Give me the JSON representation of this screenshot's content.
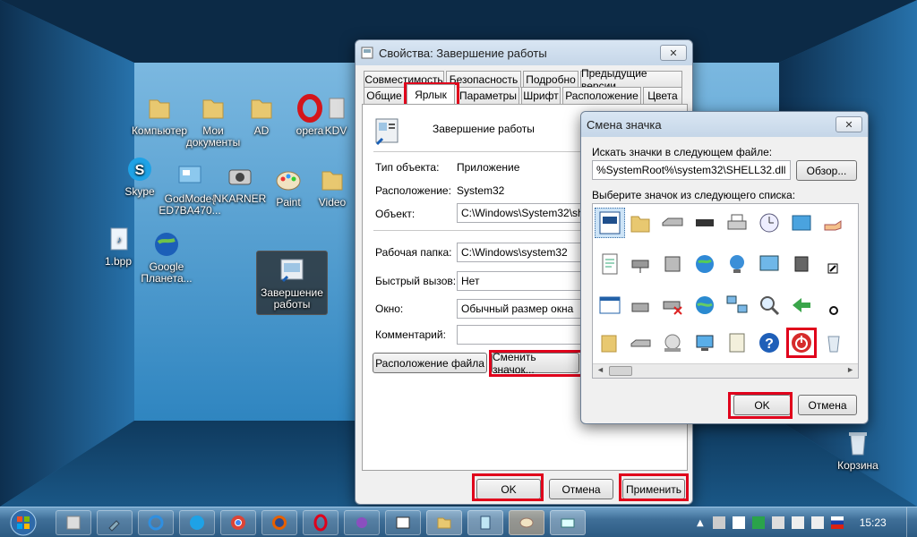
{
  "desktop": {
    "icons": [
      {
        "label": "Компьютер",
        "icon": "folder-icon"
      },
      {
        "label": "Мои документы",
        "icon": "folder-icon"
      },
      {
        "label": "AD",
        "icon": "folder-icon"
      },
      {
        "label": "opera",
        "icon": "opera-icon"
      },
      {
        "label": "KDV",
        "icon": "generic-icon"
      },
      {
        "label": "Skype",
        "icon": "skype-icon"
      },
      {
        "label": "GodMode{ ED7BA470...",
        "icon": "control-panel-icon"
      },
      {
        "label": "NKARNER",
        "icon": "camera-icon"
      },
      {
        "label": "Paint",
        "icon": "paint-icon"
      },
      {
        "label": "Video",
        "icon": "folder-icon"
      },
      {
        "label": "1.bpp",
        "icon": "media-file-icon"
      },
      {
        "label": "Google Планета...",
        "icon": "google-earth-icon"
      },
      {
        "label": "Завершение работы",
        "icon": "shutdown-shortcut-icon"
      },
      {
        "label": "Корзина",
        "icon": "recycle-bin-icon"
      }
    ]
  },
  "properties": {
    "title": "Свойства: Завершение работы",
    "close": "✕",
    "tabs_row1": [
      "Совместимость",
      "Безопасность",
      "Подробно",
      "Предыдущие версии"
    ],
    "tabs_row2": [
      "Общие",
      "Ярлык",
      "Параметры",
      "Шрифт",
      "Расположение",
      "Цвета"
    ],
    "shortcut_name": "Завершение работы",
    "type_label": "Тип объекта:",
    "type_value": "Приложение",
    "location_label": "Расположение:",
    "location_value": "System32",
    "target_label": "Объект:",
    "target_value": "C:\\Windows\\System32\\shut",
    "workdir_label": "Рабочая папка:",
    "workdir_value": "C:\\Windows\\system32",
    "hotkey_label": "Быстрый вызов:",
    "hotkey_value": "Нет",
    "window_label": "Окно:",
    "window_value": "Обычный размер окна",
    "comment_label": "Комментарий:",
    "comment_value": "",
    "open_location_button": "Расположение файла",
    "change_icon_button": "Сменить значок...",
    "ok": "OK",
    "cancel": "Отмена",
    "apply": "Применить"
  },
  "change_icon": {
    "title": "Смена значка",
    "close": "✕",
    "file_label": "Искать значки в следующем файле:",
    "file_value": "%SystemRoot%\\system32\\SHELL32.dll",
    "browse": "Обзор...",
    "list_label": "Выберите значок из следующего списка:",
    "ok": "OK",
    "cancel": "Отмена",
    "selected_icon": "shutdown-power-icon"
  },
  "taskbar": {
    "start": "start-orb-icon",
    "time": "15:23",
    "items": [
      "explorer-icon",
      "tools-icon",
      "ie-icon",
      "skype-icon",
      "chrome-icon",
      "firefox-icon",
      "opera-icon",
      "media-icon",
      "window-icon",
      "folder-icon",
      "notepad-icon",
      "paint-icon",
      "mail-icon"
    ]
  },
  "colors": {
    "highlight": "#e0001b",
    "desktop": "#2a7fb9",
    "taskbar": "#3f6f98"
  }
}
